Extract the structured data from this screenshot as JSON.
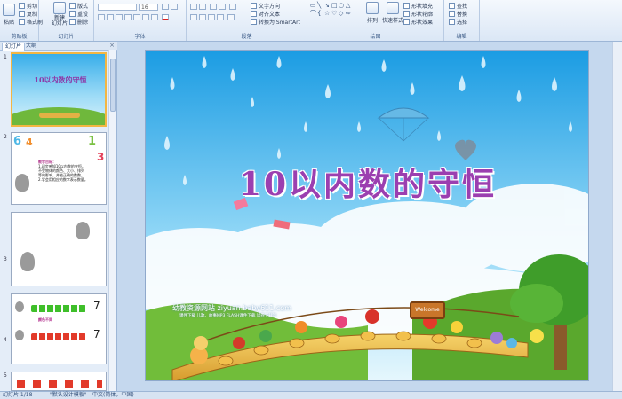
{
  "ribbon": {
    "clipboard": {
      "paste": "粘贴",
      "cut": "剪切",
      "copy": "复制",
      "format_painter": "格式刷",
      "label": "剪贴板"
    },
    "slides": {
      "new_slide": "新建\n幻灯片",
      "layout": "版式",
      "reset": "重设",
      "delete": "删除",
      "label": "幻灯片"
    },
    "font": {
      "font_name": "",
      "font_size": "16",
      "label": "字体"
    },
    "paragraph": {
      "text_direction": "文字方向",
      "align_text": "对齐文本",
      "smartart": "转换为 SmartArt",
      "label": "段落"
    },
    "drawing": {
      "arrange": "排列",
      "quick_styles": "快速样式",
      "shape_fill": "形状填充",
      "shape_outline": "形状轮廓",
      "shape_effects": "形状效果",
      "label": "绘图"
    },
    "editing": {
      "find": "查找",
      "replace": "替换",
      "select": "选择",
      "label": "编辑"
    }
  },
  "left_panel": {
    "tabs": [
      "幻灯片",
      "大纲"
    ],
    "close": "×",
    "thumbs": [
      {
        "num": "1",
        "title": "10以内数的守恒"
      },
      {
        "num": "2",
        "lines": [
          "教学目标：",
          "1.初步感知10以内数的守恒，",
          "不受物体的颜色、大小、排列",
          "等的影响，并能正确的数数。",
          "2.学会用相应的数字表示数量。"
        ]
      },
      {
        "num": "3"
      },
      {
        "num": "4",
        "numbers": [
          "7",
          "7"
        ],
        "caption": "颜色不同"
      },
      {
        "num": "5"
      }
    ]
  },
  "slide": {
    "title": "10以内数的守恒",
    "site": "幼教资源网站  ziyuan.baby611.com",
    "site_sub": "课件下载  儿歌、故事MP3  FLASH课件下载  试卷下载等",
    "welcome": "Welcome"
  },
  "status": {
    "slide_info": "幻灯片 1/18",
    "theme": "\"默认设计模板\"",
    "language": "中文(简体，中国)"
  },
  "colors": {
    "accent": "#9b3fb0",
    "sky_top": "#2aa4e6",
    "sky_bottom": "#bfe9fb"
  }
}
